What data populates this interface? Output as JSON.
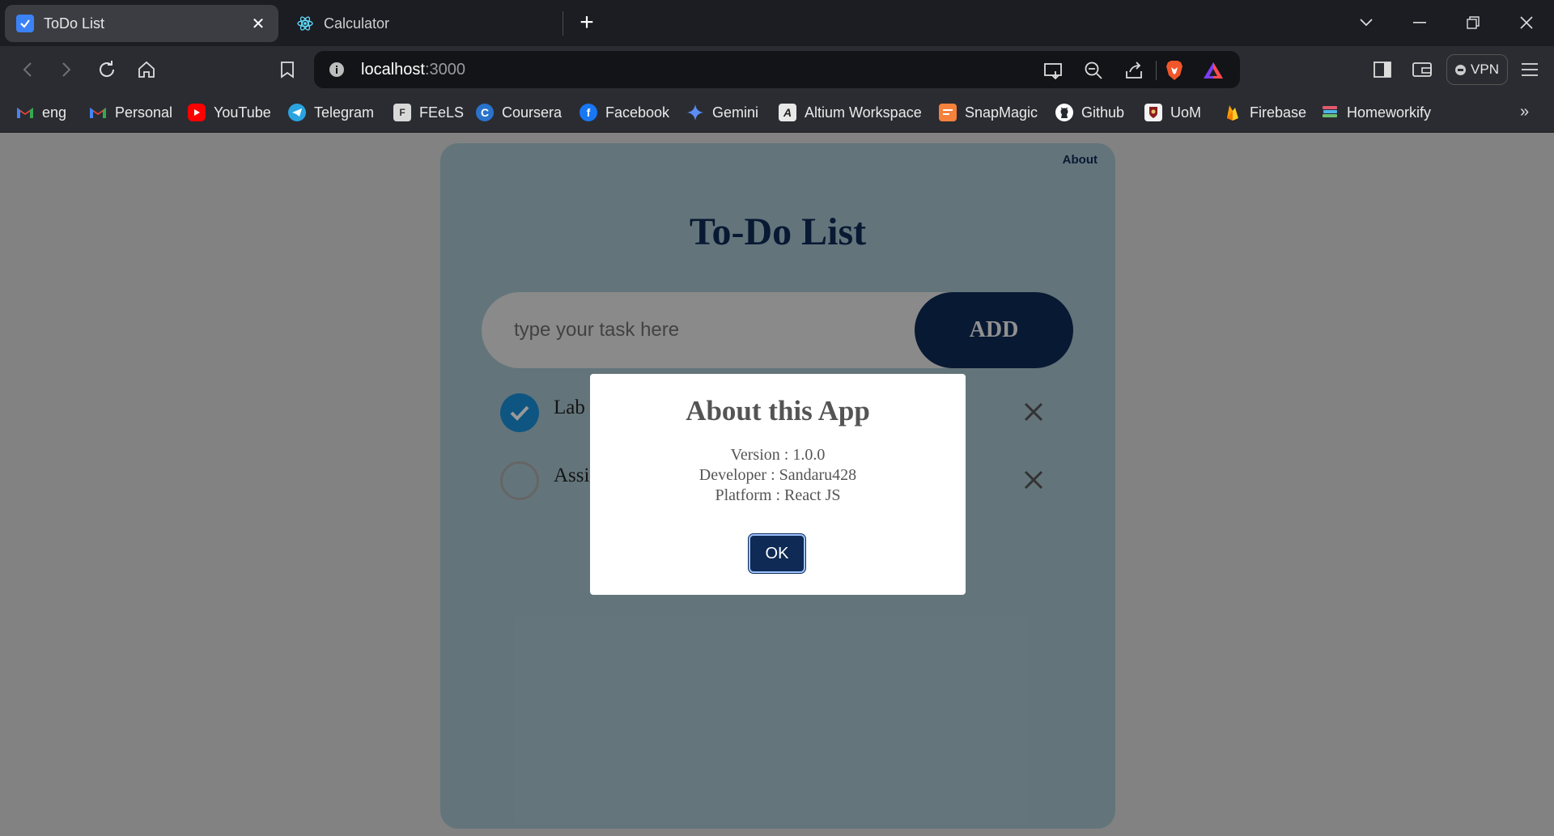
{
  "browser": {
    "tabs": [
      {
        "title": "ToDo List",
        "active": true,
        "icon": "todo-favicon"
      },
      {
        "title": "Calculator",
        "active": false,
        "icon": "react-favicon"
      }
    ],
    "address": {
      "host": "localhost",
      "port": ":3000"
    },
    "vpn_label": "VPN",
    "bookmarks": [
      {
        "label": "eng",
        "icon": "gmail-icon"
      },
      {
        "label": "Personal",
        "icon": "gmail-icon"
      },
      {
        "label": "YouTube",
        "icon": "youtube-icon"
      },
      {
        "label": "Telegram",
        "icon": "telegram-icon"
      },
      {
        "label": "FEeLS",
        "icon": "feels-icon"
      },
      {
        "label": "Coursera",
        "icon": "coursera-icon"
      },
      {
        "label": "Facebook",
        "icon": "facebook-icon"
      },
      {
        "label": "Gemini",
        "icon": "gemini-icon"
      },
      {
        "label": "Altium Workspace",
        "icon": "altium-icon"
      },
      {
        "label": "SnapMagic",
        "icon": "snapmagic-icon"
      },
      {
        "label": "Github",
        "icon": "github-icon"
      },
      {
        "label": "UoM",
        "icon": "uom-icon"
      },
      {
        "label": "Firebase",
        "icon": "firebase-icon"
      },
      {
        "label": "Homeworkify",
        "icon": "homeworkify-icon"
      }
    ]
  },
  "app": {
    "about_link": "About",
    "title": "To-Do List",
    "input_placeholder": "type your task here",
    "add_label": "ADD",
    "tasks": [
      {
        "text": "Lab",
        "done": true
      },
      {
        "text": "Assi",
        "done": false
      }
    ]
  },
  "modal": {
    "title": "About this App",
    "version": "Version : 1.0.0",
    "developer": "Developer : Sandaru428",
    "platform": "Platform : React JS",
    "ok_label": "OK"
  },
  "colors": {
    "primary_navy": "#0e2a55",
    "check_blue": "#1a8ed8",
    "card_bg": "#a6c3cd"
  }
}
